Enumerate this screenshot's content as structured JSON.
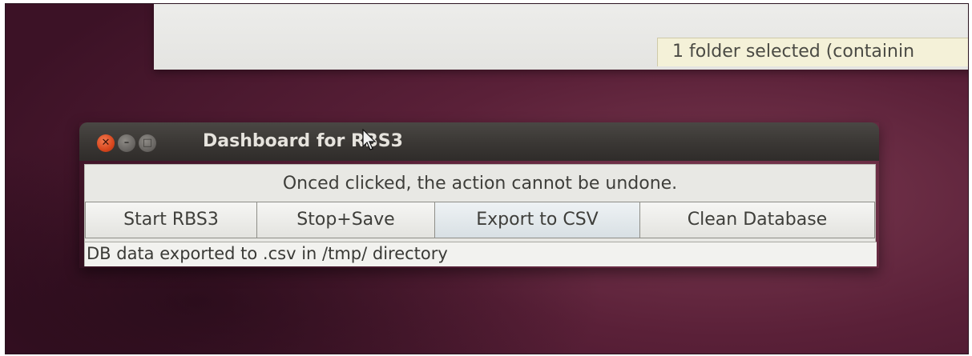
{
  "file_window": {
    "status_text": "1 folder selected (containin"
  },
  "dashboard": {
    "title": "Dashboard for RBS3",
    "window_controls": {
      "close_icon": "✕",
      "minimize_icon": "–",
      "maximize_icon": "□"
    },
    "warning": "Onced clicked, the action cannot be undone.",
    "buttons": [
      {
        "label": "Start RBS3"
      },
      {
        "label": "Stop+Save"
      },
      {
        "label": "Export to CSV"
      },
      {
        "label": "Clean Database"
      }
    ],
    "status_message": "DB data exported to .csv in /tmp/ directory"
  },
  "colors": {
    "desktop": "#5a2038",
    "titlebar": "#3a3734",
    "close_button": "#d8461d",
    "panel": "#e8e8e4",
    "status_tooltip": "#f4f1d8"
  }
}
